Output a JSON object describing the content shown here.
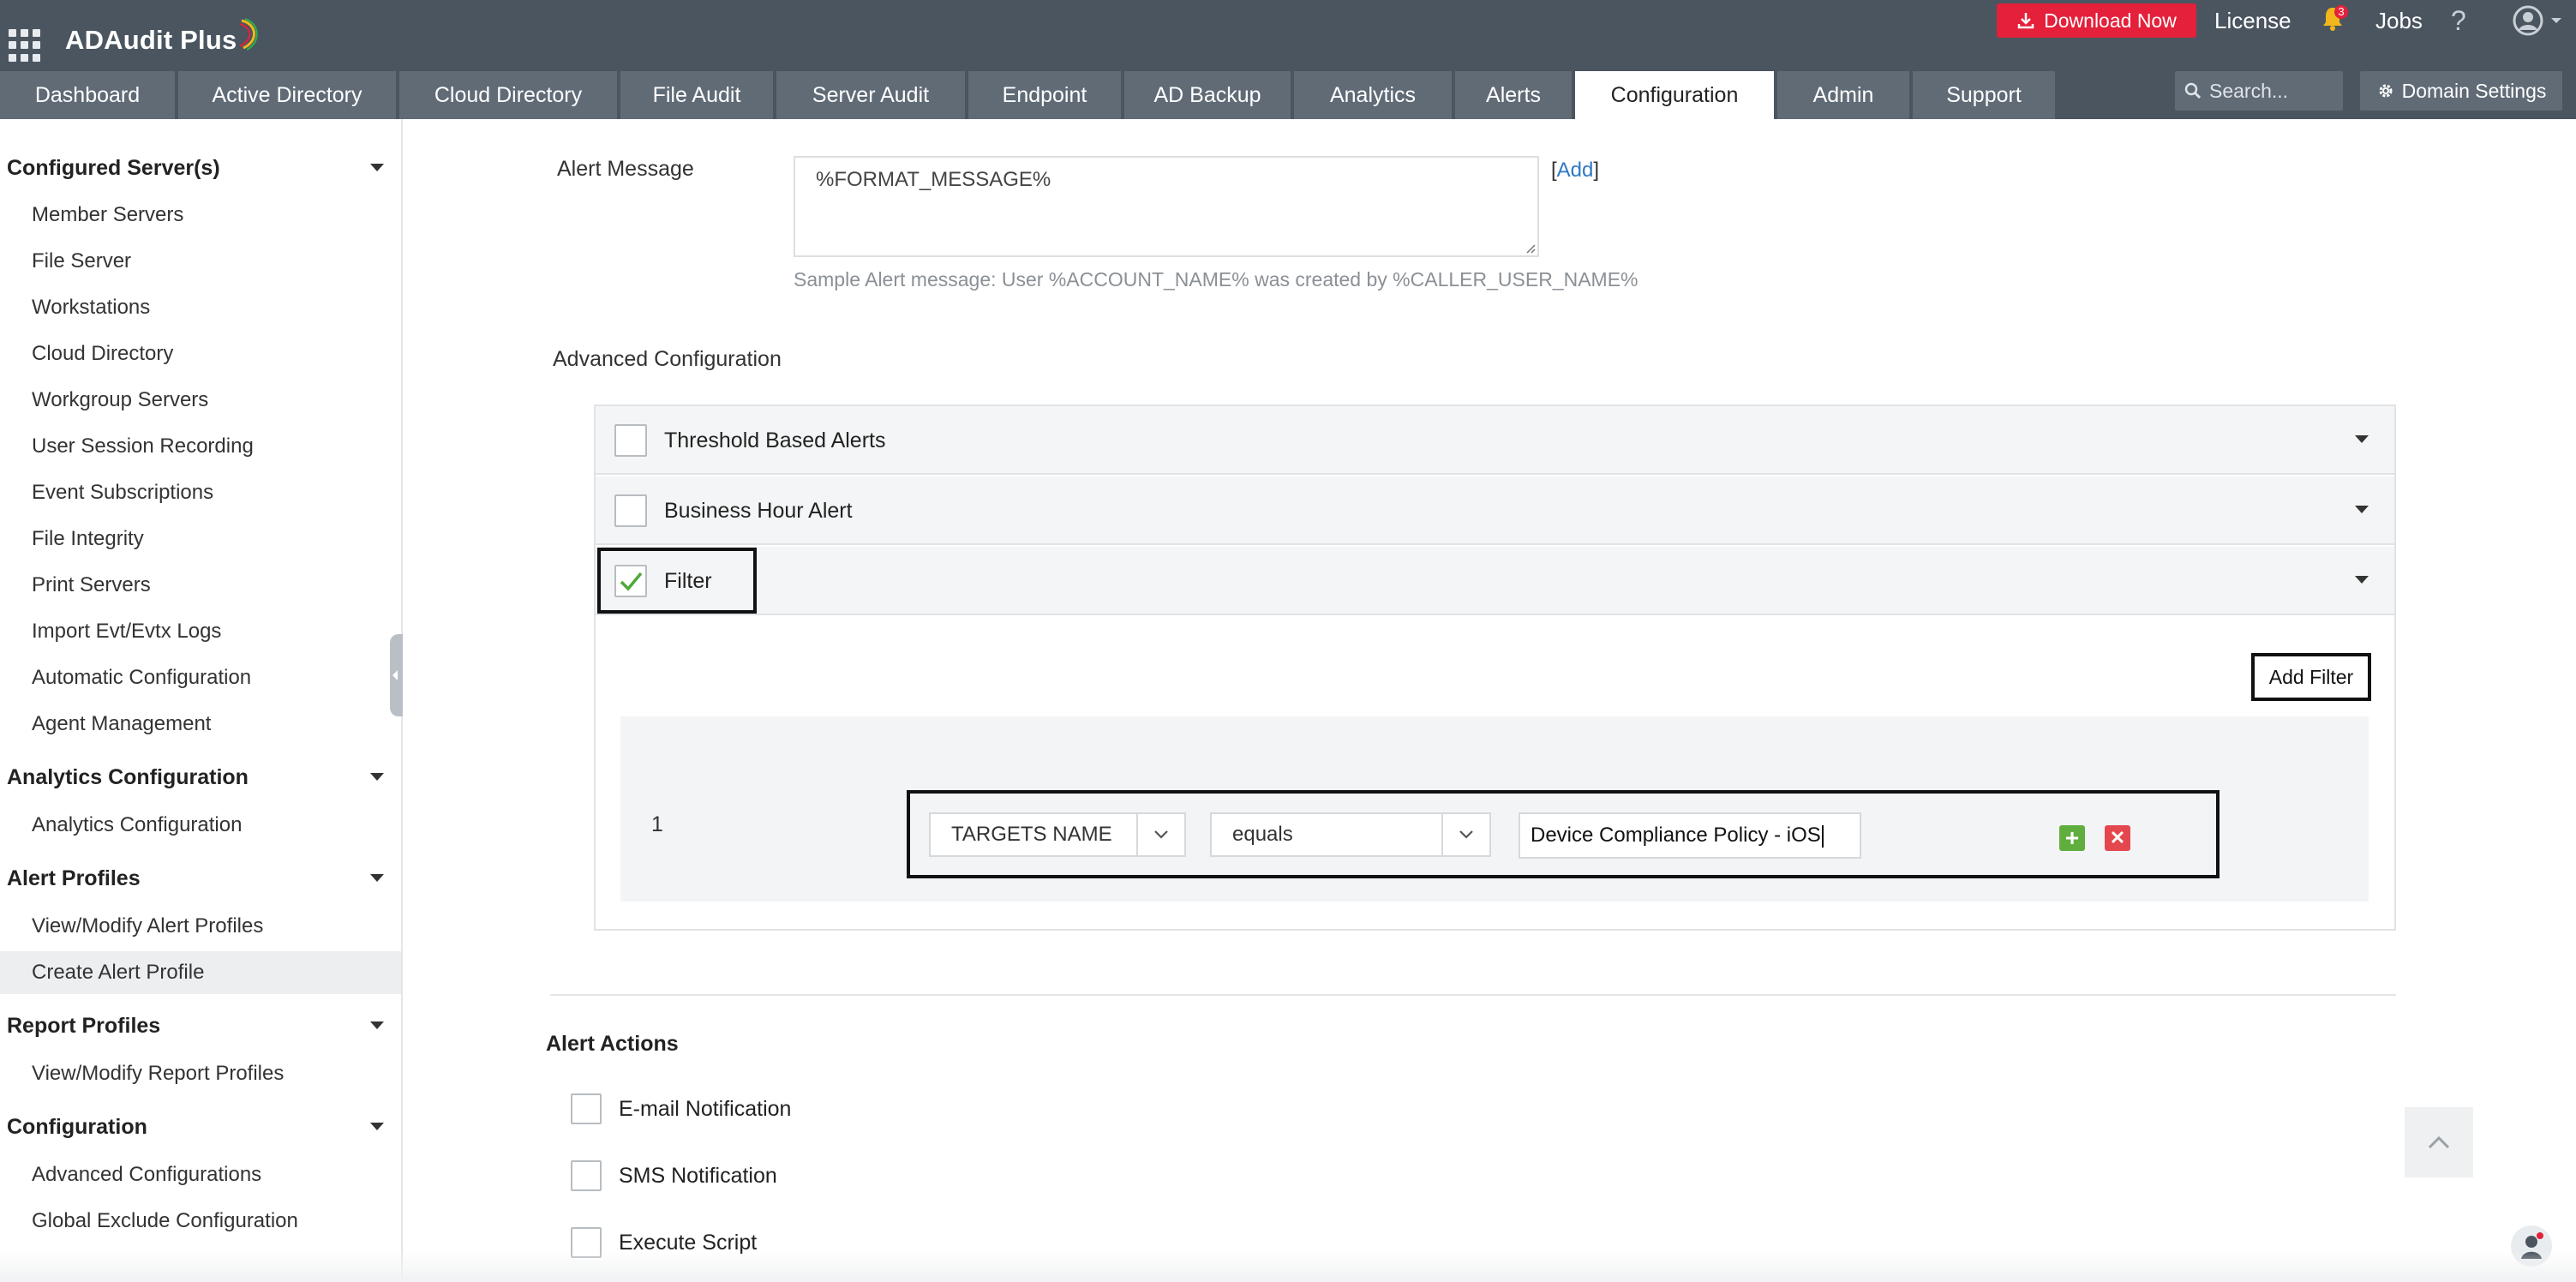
{
  "header": {
    "app_name": "ADAudit Plus",
    "download_label": "Download Now",
    "license_label": "License",
    "notification_count": "3",
    "jobs_label": "Jobs",
    "help_glyph": "?",
    "brand_color": "#4a5560",
    "accent_color": "#e4203a"
  },
  "tabs": [
    {
      "label": "Dashboard"
    },
    {
      "label": "Active Directory"
    },
    {
      "label": "Cloud Directory"
    },
    {
      "label": "File Audit"
    },
    {
      "label": "Server Audit"
    },
    {
      "label": "Endpoint"
    },
    {
      "label": "AD Backup"
    },
    {
      "label": "Analytics"
    },
    {
      "label": "Alerts"
    },
    {
      "label": "Configuration",
      "active": true
    },
    {
      "label": "Admin"
    },
    {
      "label": "Support"
    }
  ],
  "search": {
    "placeholder": "Search..."
  },
  "domain_settings_label": "Domain Settings",
  "sidebar": {
    "sections": [
      {
        "title": "Configured Server(s)",
        "items": [
          "Member Servers",
          "File Server",
          "Workstations",
          "Cloud Directory",
          "Workgroup Servers",
          "User Session Recording",
          "Event Subscriptions",
          "File Integrity",
          "Print Servers",
          "Import Evt/Evtx Logs",
          "Automatic Configuration",
          "Agent Management"
        ]
      },
      {
        "title": "Analytics Configuration",
        "items": [
          "Analytics Configuration"
        ]
      },
      {
        "title": "Alert Profiles",
        "items": [
          "View/Modify Alert Profiles",
          "Create Alert Profile"
        ]
      },
      {
        "title": "Report Profiles",
        "items": [
          "View/Modify Report Profiles"
        ]
      },
      {
        "title": "Configuration",
        "items": [
          "Advanced Configurations",
          "Global Exclude Configuration"
        ]
      }
    ],
    "active_item": "Create Alert Profile"
  },
  "main": {
    "alert_message_label": "Alert Message",
    "alert_message_value": "%FORMAT_MESSAGE%",
    "add_link_open": "[",
    "add_link_label": "Add",
    "add_link_close": "]",
    "sample_hint": "Sample Alert message: User %ACCOUNT_NAME% was created by %CALLER_USER_NAME%",
    "advanced_config_label": "Advanced Configuration",
    "accordions": [
      {
        "label": "Threshold Based Alerts",
        "checked": false
      },
      {
        "label": "Business Hour Alert",
        "checked": false
      },
      {
        "label": "Filter",
        "checked": true
      }
    ],
    "add_filter_label": "Add Filter",
    "filter": {
      "index": "1",
      "field": "TARGETS NAME",
      "operator": "equals",
      "value": "Device Compliance Policy - iOS"
    },
    "alert_actions_label": "Alert Actions",
    "actions": [
      {
        "label": "E-mail Notification",
        "checked": false
      },
      {
        "label": "SMS Notification",
        "checked": false
      },
      {
        "label": "Execute Script",
        "checked": false
      }
    ]
  }
}
